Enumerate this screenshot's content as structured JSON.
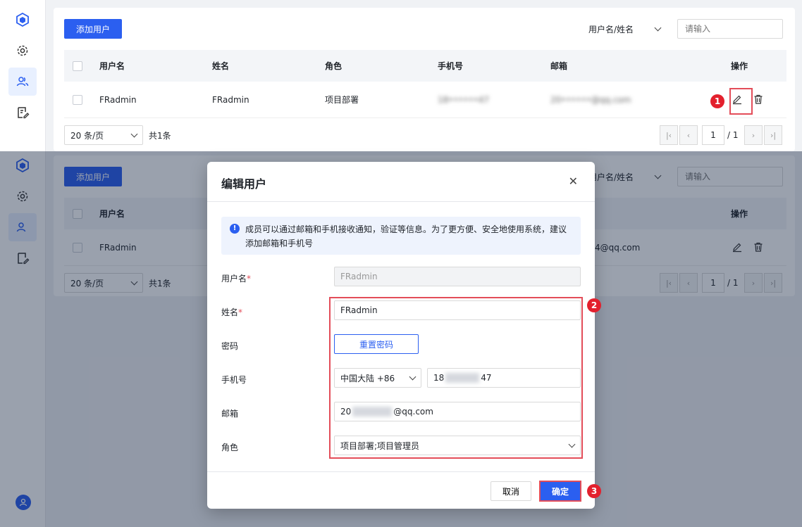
{
  "nav": {
    "icons": [
      "cube-logo-icon",
      "gear-icon",
      "users-icon",
      "edit-doc-icon"
    ],
    "user_icon": "user-avatar-icon"
  },
  "toolbar": {
    "add_user": "添加用户",
    "filter_field": "用户名/姓名",
    "search_placeholder": "请输入"
  },
  "table": {
    "headers": [
      "用户名",
      "姓名",
      "角色",
      "手机号",
      "邮箱",
      "操作"
    ],
    "rows": [
      {
        "username": "FRadmin",
        "name": "FRadmin",
        "role": "项目部署",
        "phone": "18••••••47",
        "email": "20••••••@qq.com",
        "email_visible_tail": "4@qq.com"
      }
    ]
  },
  "pagination": {
    "page_size": "20 条/页",
    "total": "共1条",
    "current": "1",
    "of": "/ 1"
  },
  "modal": {
    "title": "编辑用户",
    "notice": "成员可以通过邮箱和手机接收通知，验证等信息。为了更方便、安全地使用系统，建议添加邮箱和手机号",
    "labels": {
      "username": "用户名",
      "name": "姓名",
      "password": "密码",
      "phone": "手机号",
      "email": "邮箱",
      "role": "角色"
    },
    "required_mark": "*",
    "values": {
      "username": "FRadmin",
      "name": "FRadmin",
      "phone_region": "中国大陆 +86",
      "phone_prefix": "18",
      "phone_suffix": "47",
      "email_prefix": "20",
      "email_suffix": "@qq.com",
      "role": "项目部署;项目管理员"
    },
    "reset_password": "重置密码",
    "cancel": "取消",
    "confirm": "确定"
  },
  "callouts": [
    "1",
    "2",
    "3"
  ],
  "colors": {
    "primary": "#2b5ff0",
    "callout": "#e3202d"
  }
}
